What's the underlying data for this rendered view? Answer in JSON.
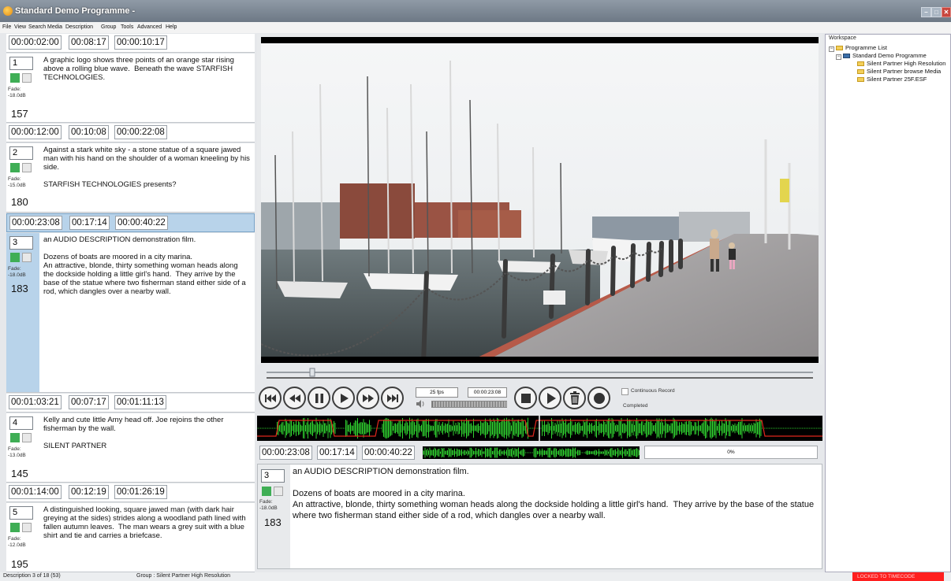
{
  "window": {
    "title": "Standard Demo Programme -"
  },
  "menu": [
    "File",
    "View",
    "Search",
    "Media",
    "Description",
    "Group",
    "Tools",
    "Advanced",
    "Help"
  ],
  "descriptions": [
    {
      "tc_in": "00:00:02:00",
      "tc_len": "00:08:17",
      "tc_out": "00:00:10:17",
      "num": "1",
      "fade_label": "Fade:",
      "fade_db": "-18.0dB",
      "duration": "157",
      "text": "A graphic logo shows three points of an orange star rising above a rolling blue wave.  Beneath the wave STARFISH TECHNOLOGIES.",
      "selected": false
    },
    {
      "tc_in": "00:00:12:00",
      "tc_len": "00:10:08",
      "tc_out": "00:00:22:08",
      "num": "2",
      "fade_label": "Fade:",
      "fade_db": "-15.0dB",
      "duration": "180",
      "text": "Against a stark white sky - a stone statue of a square jawed man with his hand on the shoulder of a woman kneeling by his side.\n\nSTARFISH TECHNOLOGIES presents?",
      "selected": false
    },
    {
      "tc_in": "00:00:23:08",
      "tc_len": "00:17:14",
      "tc_out": "00:00:40:22",
      "num": "3",
      "fade_label": "Fade:",
      "fade_db": "-18.0dB",
      "duration": "183",
      "text": "an AUDIO DESCRIPTION demonstration film.\n\nDozens of boats are moored in a city marina.\nAn attractive, blonde, thirty something woman heads along the dockside holding a little girl's hand.  They arrive by the base of the statue where two fisherman stand either side of a rod, which dangles over a nearby wall.",
      "selected": true
    },
    {
      "tc_in": "00:01:03:21",
      "tc_len": "00:07:17",
      "tc_out": "00:01:11:13",
      "num": "4",
      "fade_label": "Fade:",
      "fade_db": "-13.0dB",
      "duration": "145",
      "text": "Kelly and cute little Amy head off. Joe rejoins the other fisherman by the wall.\n\nSILENT PARTNER",
      "selected": false
    },
    {
      "tc_in": "00:01:14:00",
      "tc_len": "00:12:19",
      "tc_out": "00:01:26:19",
      "num": "5",
      "fade_label": "Fade:",
      "fade_db": "-12.0dB",
      "duration": "195",
      "text": "A distinguished looking, square jawed man (with dark hair greying at the sides) strides along a woodland path lined with fallen autumn leaves.  The man wears a grey suit with a blue shirt and tie and carries a briefcase.",
      "selected": false
    }
  ],
  "transport": {
    "fps": "25 fps",
    "timecode": "00:00:23:08",
    "continuous_record": "Continuous Record",
    "status": "Completed"
  },
  "current": {
    "tc_in": "00:00:23:08",
    "tc_len": "00:17:14",
    "tc_out": "00:00:40:22",
    "progress": "0%",
    "num": "3",
    "fade_label": "Fade:",
    "fade_db": "-18.0dB",
    "duration": "183",
    "text": "an AUDIO DESCRIPTION demonstration film.\n\nDozens of boats are moored in a city marina.\nAn attractive, blonde, thirty something woman heads along the dockside holding a little girl's hand.  They arrive by the base of the statue where two fisherman stand either side of a rod, which dangles over a nearby wall."
  },
  "workspace": {
    "title": "Workspace",
    "root": "Programme List",
    "programme": "Standard Demo Programme",
    "items": [
      "Silent Partner High Resolution",
      "Silent Partner browse Media",
      "Silent Partner 25F.ESF"
    ]
  },
  "statusbar": {
    "description": "Description 3 of 18 (53)",
    "group": "Group : Silent Partner High Resolution",
    "locked": "LOCKED TO TIMECODE"
  },
  "colors": {
    "selection": "#b8d3ea",
    "fade_on": "#3fae55",
    "waveform": "#2fd12f",
    "cue": "#e0261d",
    "locked": "#ff1f1f"
  },
  "icons": [
    "app-icon",
    "minimize-icon",
    "maximize-icon",
    "close-icon",
    "skip-start-icon",
    "rewind-icon",
    "pause-icon",
    "play-icon",
    "fast-forward-icon",
    "skip-end-icon",
    "speaker-icon",
    "stop-icon",
    "play-cue-icon",
    "trash-icon",
    "record-icon",
    "folder-icon",
    "programme-icon"
  ]
}
